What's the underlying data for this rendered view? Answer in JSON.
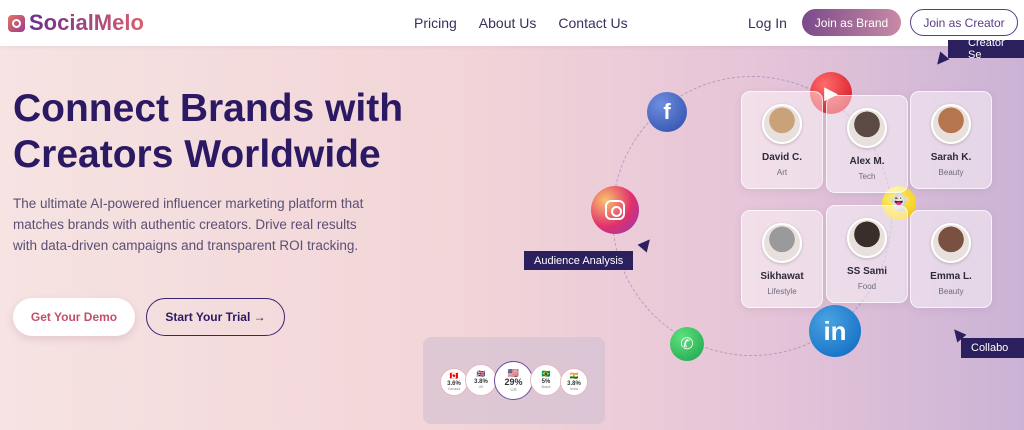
{
  "brand": {
    "name": "SocialMelo"
  },
  "nav": {
    "links": [
      "Pricing",
      "About Us",
      "Contact Us"
    ],
    "login": "Log In",
    "join_brand": "Join as Brand",
    "join_creator": "Join as Creator"
  },
  "hero": {
    "title": "Connect Brands with Creators Worldwide",
    "description": "The ultimate AI-powered influencer marketing platform that matches brands with authentic creators. Drive real results with data-driven campaigns and transparent ROI tracking.",
    "demo_button": "Get Your Demo",
    "trial_button": "Start Your Trial →"
  },
  "creators": [
    {
      "name": "David C.",
      "category": "Art",
      "color": "#c9a27a"
    },
    {
      "name": "Alex M.",
      "category": "Tech",
      "color": "#5b4a44"
    },
    {
      "name": "Sarah K.",
      "category": "Beauty",
      "color": "#b5764f"
    },
    {
      "name": "Sikhawat",
      "category": "Lifestyle",
      "color": "#9a9a9a"
    },
    {
      "name": "SS Sami",
      "category": "Food",
      "color": "#3a2e2a"
    },
    {
      "name": "Emma L.",
      "category": "Beauty",
      "color": "#7a5040"
    }
  ],
  "tags": {
    "audience": "Audience Analysis",
    "creator_search": "Creator Se",
    "collab": "Collabo"
  },
  "social_icons": [
    "facebook-icon",
    "youtube-icon",
    "instagram-icon",
    "snapchat-icon",
    "linkedin-icon",
    "whatsapp-icon"
  ],
  "countries": [
    {
      "flag": "🇨🇦",
      "pct": "3.6%",
      "label": "Canada"
    },
    {
      "flag": "🇬🇧",
      "pct": "3.8%",
      "label": "UK"
    },
    {
      "flag": "🇺🇸",
      "pct": "29%",
      "label": "US"
    },
    {
      "flag": "🇧🇷",
      "pct": "5%",
      "label": "Brazil"
    },
    {
      "flag": "🇮🇳",
      "pct": "3.8%",
      "label": "India"
    }
  ]
}
